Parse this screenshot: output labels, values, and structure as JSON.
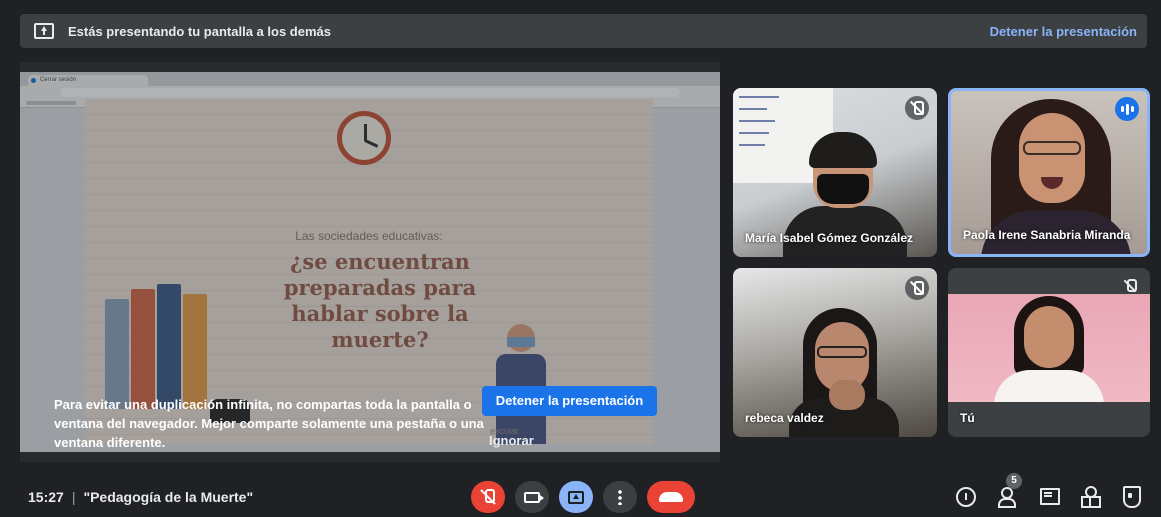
{
  "banner": {
    "message": "Estás presentando tu pantalla a los demás",
    "stop_link": "Detener la presentación"
  },
  "shared_screen": {
    "browser_tab": "Cerrar sesión",
    "slide": {
      "subtitle": "Las sociedades educativas:",
      "headline": "¿se encuentran preparadas para hablar sobre la muerte?",
      "footer_fragment": "escolar"
    },
    "warning": "Para evitar una duplicación infinita, no compartas toda la pantalla o ventana del navegador. Mejor comparte solamente una pestaña o una ventana diferente.",
    "stop_button": "Detener la presentación",
    "ignore_button": "Ignorar"
  },
  "participants": [
    {
      "name": "María Isabel Gómez González",
      "muted": true
    },
    {
      "name": "Paola Irene Sanabria Miranda",
      "muted": false,
      "speaking": true
    },
    {
      "name": "rebeca valdez",
      "muted": true
    },
    {
      "name": "Tú",
      "muted": true
    }
  ],
  "bottom_bar": {
    "time": "15:27",
    "separator": "|",
    "meeting_title": "\"Pedagogía de la Muerte\"",
    "people_count": "5",
    "icons": [
      "mic-off-icon",
      "camera-icon",
      "present-screen-icon",
      "more-options-icon",
      "end-call-icon",
      "info-icon",
      "people-icon",
      "chat-icon",
      "activities-icon",
      "host-controls-icon"
    ]
  },
  "colors": {
    "background": "#202124",
    "banner": "#3c4043",
    "accent_blue": "#8ab4f8",
    "primary_button": "#1a73e8",
    "danger_red": "#ea4335"
  }
}
